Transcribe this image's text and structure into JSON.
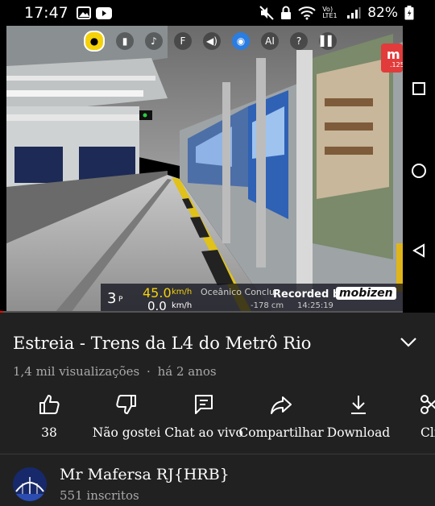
{
  "status_bar": {
    "time": "17:47",
    "battery": "82%",
    "network": "Vo) LTE1"
  },
  "video_overlay": {
    "hud_letters": [
      "F",
      "AI",
      "?"
    ],
    "level": "3",
    "level_suffix": "P",
    "speed": "45.0",
    "speed_unit": "km/h",
    "speed2": "0.0",
    "speed2_unit": "km/h",
    "station": "Oceânico Conclu",
    "distance": "-178 cm",
    "clock": "14:25:19",
    "recorded_by": "Recorded by",
    "mobizen": "mobizen",
    "corner_badge": "m",
    "corner_sub": ".125"
  },
  "video": {
    "title": "Estreia - Trens da L4 do Metrô Rio",
    "views": "1,4 mil visualizações",
    "separator": "·",
    "age": "há 2 anos"
  },
  "actions": {
    "like_count": "38",
    "dislike": "Não gostei",
    "chat": "Chat ao vivo",
    "share": "Compartilhar",
    "download": "Download",
    "clip": "Cli"
  },
  "channel": {
    "name": "Mr Mafersa RJ{HRB}",
    "subscribers": "551 inscritos"
  },
  "colors": {
    "background": "#212121",
    "progress": "#ff0000",
    "hud_accent": "#f5d10a",
    "secondary_text": "#aaaaaa"
  }
}
